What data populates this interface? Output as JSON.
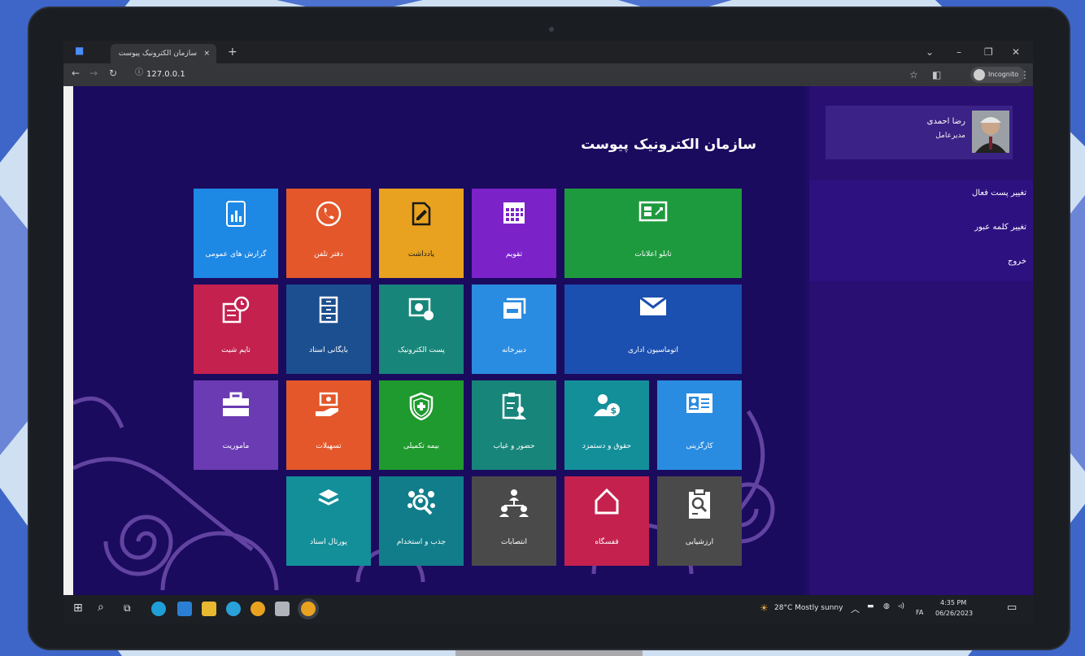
{
  "browser": {
    "tab_title": "سازمان الکترونیک پیوست",
    "tab_close": "×",
    "new_tab": "+",
    "url": "127.0.0.1",
    "incognito_label": "Incognito"
  },
  "page": {
    "title": "سازمان الکترونیک پیوست"
  },
  "profile": {
    "name": "رضا احمدی",
    "role": "مدیرعامل"
  },
  "sidebar_menu": [
    {
      "label": "تغییر پست فعال"
    },
    {
      "label": "تغییر کلمه عبور"
    },
    {
      "label": "خروج"
    }
  ],
  "tiles": [
    {
      "label": "گزارش های عمومی",
      "icon": "report-icon",
      "color": "#1e88e5"
    },
    {
      "label": "دفتر تلفن",
      "icon": "phone-icon",
      "color": "#e3572a"
    },
    {
      "label": "یادداشت",
      "icon": "note-icon",
      "color": "#e8a21f"
    },
    {
      "label": "تقویم",
      "icon": "calendar-icon",
      "color": "#7b22c9"
    },
    {
      "label": "تابلو اعلانات",
      "icon": "board-icon",
      "color": "#1e9a3e"
    },
    {
      "label": "تایم شیت",
      "icon": "timesheet-icon",
      "color": "#c4214f"
    },
    {
      "label": "بایگانی اسناد",
      "icon": "archive-icon",
      "color": "#1c4f8f"
    },
    {
      "label": "پست الکترونیک",
      "icon": "email-icon",
      "color": "#17857a"
    },
    {
      "label": "دبیرخانه",
      "icon": "secretariat-icon",
      "color": "#2a8ce0"
    },
    {
      "label": "اتوماسیون اداری",
      "icon": "mail-icon",
      "color": "#1b4fb0"
    },
    {
      "label": "ماموریت",
      "icon": "briefcase-icon",
      "color": "#6b3bb3"
    },
    {
      "label": "تسهیلات",
      "icon": "money-hand-icon",
      "color": "#e3572a"
    },
    {
      "label": "بیمه تکمیلی",
      "icon": "shield-icon",
      "color": "#1f9a2e"
    },
    {
      "label": "حضور و غیاب",
      "icon": "attendance-icon",
      "color": "#17857a"
    },
    {
      "label": "حقوق و دستمزد",
      "icon": "salary-icon",
      "color": "#138f9a"
    },
    {
      "label": "کارگزینی",
      "icon": "id-card-icon",
      "color": "#2a8ce0"
    },
    {
      "label": "پورتال اسناد",
      "icon": "layers-icon",
      "color": "#138f9a"
    },
    {
      "label": "جذب و استخدام",
      "icon": "recruit-icon",
      "color": "#117d8a"
    },
    {
      "label": "انتصابات",
      "icon": "org-chart-icon",
      "color": "#4a4a4a"
    },
    {
      "label": "قفسگاه",
      "icon": "home-icon",
      "color": "#c4214f"
    },
    {
      "label": "ارزشیابی",
      "icon": "evaluation-icon",
      "color": "#4a4a4a"
    }
  ],
  "taskbar": {
    "weather": "28°C  Mostly sunny",
    "lang": "FA",
    "time": "4:35 PM",
    "date": "06/26/2023"
  }
}
